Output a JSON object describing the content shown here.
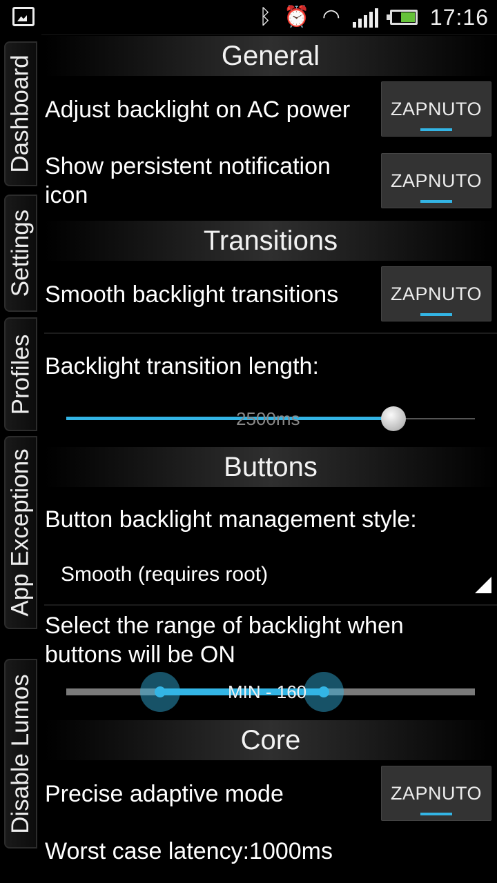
{
  "status_bar": {
    "time": "17:16",
    "icons": [
      "gallery-icon",
      "bluetooth-icon",
      "alarm-icon",
      "wifi-icon",
      "signal-icon",
      "battery-icon"
    ]
  },
  "side_tabs": [
    "Dashboard",
    "Settings",
    "Profiles",
    "App Exceptions",
    "Disable Lumos"
  ],
  "sections": {
    "general": "General",
    "transitions": "Transitions",
    "buttons": "Buttons",
    "core": "Core"
  },
  "settings": {
    "adjust_backlight": {
      "label": "Adjust backlight on AC power",
      "toggle": "ZAPNUTO"
    },
    "persistent_notification": {
      "label_line1": "Show persistent notification",
      "label_line2": "icon",
      "toggle": "ZAPNUTO"
    },
    "smooth_transitions": {
      "label": "Smooth backlight transitions",
      "toggle": "ZAPNUTO"
    },
    "transition_length": {
      "label": "Backlight transition length:",
      "value_text": "2500ms",
      "fraction": 0.8
    },
    "button_style": {
      "label": "Button backlight management style:",
      "selected": "Smooth (requires root)"
    },
    "button_range": {
      "label_line1": "Select the range of backlight when",
      "label_line2": "buttons will be ON",
      "value_text": "MIN - 160",
      "low_fraction": 0.23,
      "high_fraction": 0.63
    },
    "precise_adaptive": {
      "label": "Precise adaptive mode",
      "toggle": "ZAPNUTO"
    },
    "worst_case_latency": {
      "label": "Worst case latency:1000ms"
    }
  },
  "colors": {
    "accent": "#33b5e5",
    "background": "#000000"
  }
}
